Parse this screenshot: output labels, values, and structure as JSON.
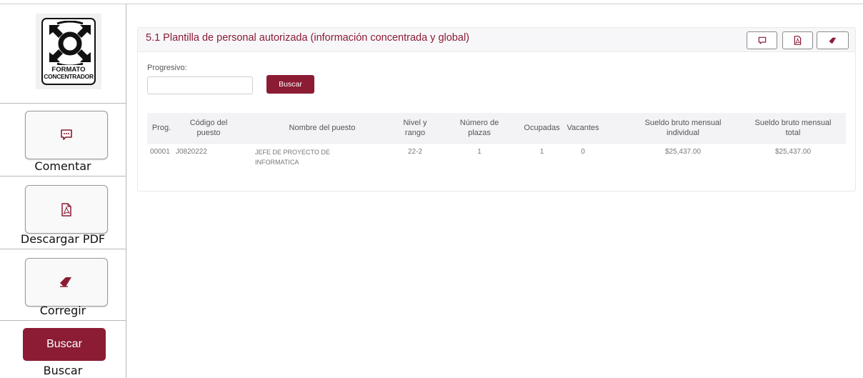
{
  "legend": {
    "logo": {
      "line1": "FORMATO",
      "line2": "CONCENTRADOR"
    },
    "comentar": {
      "label": "Comentar",
      "icon": "comment-icon"
    },
    "pdf": {
      "label": "Descargar PDF",
      "icon": "pdf-icon"
    },
    "corregir": {
      "label": "Corregir",
      "icon": "eraser-icon"
    },
    "buscar": {
      "button_label": "Buscar",
      "label": "Buscar"
    }
  },
  "panel": {
    "title": "5.1 Plantilla de personal autorizada (información concentrada y global)",
    "header_buttons": [
      {
        "icon": "comment-icon"
      },
      {
        "icon": "pdf-icon"
      },
      {
        "icon": "eraser-icon"
      }
    ],
    "progresivo_label": "Progresivo:",
    "progresivo_value": "",
    "buscar_label": "Buscar"
  },
  "table": {
    "headers": [
      [
        "Prog."
      ],
      [
        "Código del",
        "puesto"
      ],
      [
        "Nombre del puesto"
      ],
      [
        "Nivel y",
        "rango"
      ],
      [
        "Número de",
        "plazas"
      ],
      [
        "Ocupadas"
      ],
      [
        "Vacantes"
      ],
      [
        "Sueldo bruto mensual",
        "individual"
      ],
      [
        "Sueldo bruto mensual",
        "total"
      ]
    ],
    "rows": [
      {
        "prog": "00001",
        "codigo": "J0820222",
        "nombre": [
          "JEFE DE PROYECTO DE",
          "INFORMATICA"
        ],
        "nivel": "22-2",
        "plazas": "1",
        "ocupadas": "1",
        "vacantes": "0",
        "sueldo_individual": "$25,437.00",
        "sueldo_total": "$25,437.00"
      }
    ]
  },
  "colors": {
    "accent": "#8b1c34",
    "border": "#b8b8b8",
    "header_bg": "#f7f7f9"
  }
}
